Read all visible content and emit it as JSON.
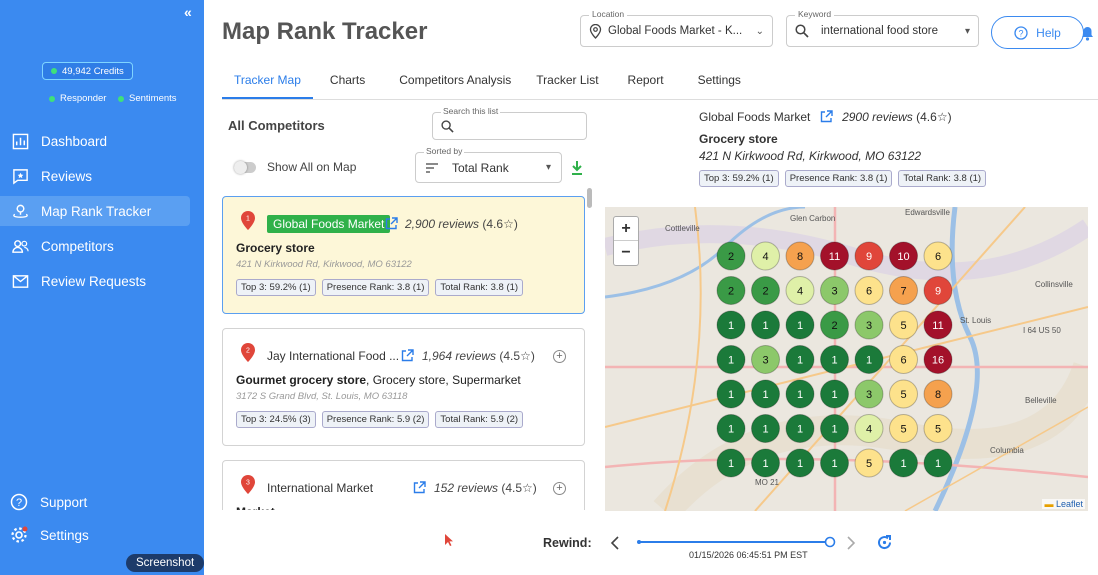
{
  "sidebar": {
    "credits": "49,942 Credits",
    "responder": "Responder",
    "sentiments": "Sentiments",
    "items": [
      {
        "label": "Dashboard"
      },
      {
        "label": "Reviews"
      },
      {
        "label": "Map Rank Tracker"
      },
      {
        "label": "Competitors"
      },
      {
        "label": "Review Requests"
      }
    ],
    "support": "Support",
    "settings": "Settings",
    "screenshot": "Screenshot"
  },
  "header": {
    "title": "Map Rank Tracker",
    "location_label": "Location",
    "location_value": "Global Foods Market - K...",
    "keyword_label": "Keyword",
    "keyword_value": "international food store",
    "help": "Help"
  },
  "tabs": [
    {
      "label": "Tracker Map"
    },
    {
      "label": "Charts"
    },
    {
      "label": "Competitors Analysis"
    },
    {
      "label": "Tracker List"
    },
    {
      "label": "Report"
    },
    {
      "label": "Settings"
    }
  ],
  "list": {
    "title": "All Competitors",
    "search_label": "Search this list",
    "show_all": "Show All on Map",
    "sort_label": "Sorted by",
    "sort_value": "Total Rank",
    "cards": [
      {
        "num": "1",
        "name": "Global Foods Market",
        "reviews": "2,900 reviews",
        "rating": "(4.6☆)",
        "type": "Grocery store",
        "type_extra": "",
        "address": "421 N Kirkwood Rd, Kirkwood, MO 63122",
        "top3_label": "Top 3:",
        "top3": "59.2% (1)",
        "presence_label": "Presence Rank:",
        "presence": "3.8 (1)",
        "total_label": "Total Rank:",
        "total": "3.8 (1)"
      },
      {
        "num": "2",
        "name": "Jay International Food ...",
        "reviews": "1,964 reviews",
        "rating": "(4.5☆)",
        "type": "Gourmet grocery store",
        "type_extra": ", Grocery store, Supermarket",
        "address": "3172 S Grand Blvd, St. Louis, MO 63118",
        "top3_label": "Top 3:",
        "top3": "24.5% (3)",
        "presence_label": "Presence Rank:",
        "presence": "5.9 (2)",
        "total_label": "Total Rank:",
        "total": "5.9 (2)"
      },
      {
        "num": "3",
        "name": "International Market",
        "reviews": "152 reviews",
        "rating": "(4.5☆)",
        "type": "Market",
        "type_extra": ""
      }
    ]
  },
  "detail": {
    "name": "Global Foods Market",
    "reviews": "2900 reviews",
    "rating": "(4.6☆)",
    "type": "Grocery store",
    "address": "421 N Kirkwood Rd, Kirkwood, MO 63122",
    "top3_label": "Top 3:",
    "top3": "59.2% (1)",
    "presence_label": "Presence Rank:",
    "presence": "3.8 (1)",
    "total_label": "Total Rank:",
    "total": "3.8 (1)"
  },
  "map": {
    "labels": [
      "Cottleville",
      "Glen Carbon",
      "Edwardsville",
      "Collinsville",
      "St. Louis",
      "Belleville",
      "Columbia",
      "I 64 US 50",
      "MO 21"
    ],
    "attribution": "Leaflet",
    "grid": [
      [
        2,
        4,
        8,
        11,
        9,
        10,
        6
      ],
      [
        2,
        2,
        4,
        3,
        6,
        7,
        9
      ],
      [
        1,
        1,
        1,
        2,
        3,
        5,
        11
      ],
      [
        1,
        3,
        1,
        1,
        1,
        6,
        16
      ],
      [
        1,
        1,
        1,
        1,
        3,
        5,
        8
      ],
      [
        1,
        1,
        1,
        1,
        4,
        5,
        5
      ],
      [
        1,
        1,
        1,
        1,
        5,
        1,
        1
      ]
    ],
    "colors": {
      "dark_green": "#1b7a3a",
      "green": "#3a9a46",
      "light_green": "#8cc86a",
      "pale": "#dff0a8",
      "yellow": "#fde28c",
      "orange": "#f5a14e",
      "red": "#e0463a",
      "dark_red": "#a3112a"
    }
  },
  "footer": {
    "rewind": "Rewind:",
    "datetime": "01/15/2026 06:45:51 PM EST"
  }
}
